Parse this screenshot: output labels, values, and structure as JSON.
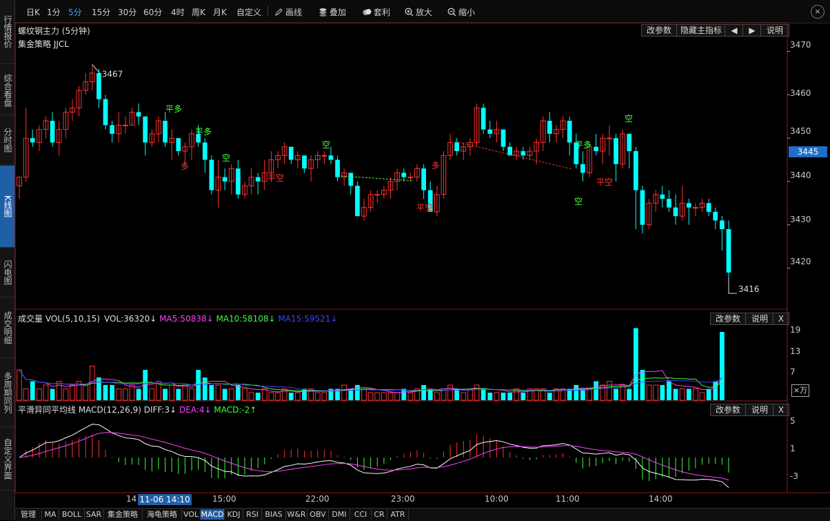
{
  "sidebar": {
    "items": [
      {
        "label": "行情报价",
        "active": false
      },
      {
        "label": "综合看盘",
        "active": false
      },
      {
        "label": "分时图",
        "active": false
      },
      {
        "label": "K线图",
        "active": true
      },
      {
        "label": "闪电图",
        "active": false
      },
      {
        "label": "成交明细",
        "active": false
      },
      {
        "label": "多周期同列",
        "active": false
      },
      {
        "label": "自定义界面",
        "active": false
      }
    ]
  },
  "toolbar": {
    "periods": [
      {
        "label": "日K",
        "active": false
      },
      {
        "label": "1分",
        "active": false
      },
      {
        "label": "5分",
        "active": true
      },
      {
        "label": "15分",
        "active": false
      },
      {
        "label": "30分",
        "active": false
      },
      {
        "label": "60分",
        "active": false
      },
      {
        "label": "4时",
        "active": false
      },
      {
        "label": "周K",
        "active": false
      },
      {
        "label": "月K",
        "active": false
      },
      {
        "label": "自定义",
        "active": false
      }
    ],
    "tools": [
      {
        "label": "画线",
        "icon": "pencil-icon"
      },
      {
        "label": "叠加",
        "icon": "stack-icon"
      },
      {
        "label": "套利",
        "icon": "coins-icon"
      },
      {
        "label": "放大",
        "icon": "zoom-in-icon"
      },
      {
        "label": "缩小",
        "icon": "zoom-out-icon"
      }
    ],
    "close": "×"
  },
  "main": {
    "contract": "螺纹钢主力 (5分钟)",
    "strategy": "集金策略 JJCL",
    "buttons": {
      "params": "改参数",
      "hide": "隐藏主指标",
      "left": "◀",
      "right": "▶",
      "help": "说明"
    },
    "high_label": "3467",
    "low_label": "3416",
    "y_ticks": [
      "3470",
      "3460",
      "3450",
      "3440",
      "3430",
      "3420"
    ],
    "current_price": "3445",
    "signals": {
      "flat_long": "平多",
      "flat_short": "平空",
      "long": "多",
      "short": "空"
    }
  },
  "volume": {
    "name": "成交量 VOL(5,10,15)",
    "vol": "VOL:36320↓",
    "ma5": "MA5:50838↓",
    "ma10": "MA10:58108↓",
    "ma15": "MA15:59521↓",
    "buttons": {
      "params": "改参数",
      "help": "说明",
      "close": "X"
    },
    "y_ticks": [
      "19",
      "13",
      "7"
    ],
    "unit": "×万",
    "colors": {
      "ma5": "#ff40ff",
      "ma10": "#40ff40",
      "ma15": "#4040ff"
    }
  },
  "macd": {
    "name": "平滑异同平均线 MACD(12,26,9)",
    "diff": "DIFF:3↓",
    "dea": "DEA:4↓",
    "macd": "MACD:-2↑",
    "buttons": {
      "params": "改参数",
      "help": "说明",
      "close": "X"
    },
    "y_ticks": [
      "5",
      "1",
      "-3"
    ],
    "colors": {
      "diff": "#ffffff",
      "dea": "#ff40ff",
      "macd": "#40ff40"
    }
  },
  "time_axis": {
    "labels": [
      "14",
      "15:00",
      "22:00",
      "23:00",
      "10:00",
      "11:00",
      "14:00"
    ],
    "cursor": "11-06 14:10"
  },
  "bottom_tabs": [
    {
      "label": "管理",
      "active": false
    },
    {
      "label": "MA",
      "active": false
    },
    {
      "label": "BOLL",
      "active": false
    },
    {
      "label": "SAR",
      "active": false
    },
    {
      "label": "集金策略",
      "active": false
    },
    {
      "label": "海龟策略",
      "active": false
    },
    {
      "label": "VOL",
      "active": false
    },
    {
      "label": "MACD",
      "active": true
    },
    {
      "label": "KDJ",
      "active": false
    },
    {
      "label": "RSI",
      "active": false
    },
    {
      "label": "BIAS",
      "active": false
    },
    {
      "label": "W&R",
      "active": false
    },
    {
      "label": "OBV",
      "active": false
    },
    {
      "label": "DMI",
      "active": false
    },
    {
      "label": "CCI",
      "active": false
    },
    {
      "label": "CR",
      "active": false
    },
    {
      "label": "ATR",
      "active": false
    }
  ],
  "chart_data": {
    "type": "candlestick",
    "ylim": [
      3415,
      3472
    ],
    "candles": [
      [
        3439,
        3441,
        3436,
        3441
      ],
      [
        3441,
        3457,
        3440,
        3450
      ],
      [
        3450,
        3452,
        3448,
        3449
      ],
      [
        3449,
        3453,
        3447,
        3452
      ],
      [
        3452,
        3455,
        3450,
        3454
      ],
      [
        3454,
        3456,
        3448,
        3449
      ],
      [
        3449,
        3454,
        3446,
        3452
      ],
      [
        3452,
        3457,
        3450,
        3456
      ],
      [
        3456,
        3459,
        3454,
        3457
      ],
      [
        3457,
        3462,
        3455,
        3461
      ],
      [
        3461,
        3465,
        3460,
        3463
      ],
      [
        3463,
        3467,
        3461,
        3465
      ],
      [
        3465,
        3466,
        3457,
        3459
      ],
      [
        3459,
        3460,
        3452,
        3453
      ],
      [
        3453,
        3454,
        3449,
        3451
      ],
      [
        3451,
        3456,
        3449,
        3453
      ],
      [
        3453,
        3455,
        3451,
        3453
      ],
      [
        3453,
        3457,
        3453,
        3456
      ],
      [
        3456,
        3458,
        3453,
        3455
      ],
      [
        3455,
        3455,
        3446,
        3449
      ],
      [
        3449,
        3452,
        3448,
        3451
      ],
      [
        3451,
        3455,
        3449,
        3454
      ],
      [
        3454,
        3456,
        3448,
        3449
      ],
      [
        3449,
        3452,
        3445,
        3450
      ],
      [
        3450,
        3450,
        3446,
        3447
      ],
      [
        3447,
        3449,
        3444,
        3448
      ],
      [
        3448,
        3452,
        3445,
        3451
      ],
      [
        3451,
        3453,
        3448,
        3449
      ],
      [
        3449,
        3450,
        3442,
        3445
      ],
      [
        3445,
        3446,
        3437,
        3438
      ],
      [
        3438,
        3445,
        3434,
        3441
      ],
      [
        3441,
        3443,
        3438,
        3440
      ],
      [
        3440,
        3444,
        3437,
        3443
      ],
      [
        3443,
        3445,
        3436,
        3437
      ],
      [
        3437,
        3440,
        3436,
        3439
      ],
      [
        3439,
        3443,
        3437,
        3441
      ],
      [
        3441,
        3442,
        3437,
        3440
      ],
      [
        3440,
        3445,
        3438,
        3442
      ],
      [
        3442,
        3447,
        3440,
        3445
      ],
      [
        3445,
        3447,
        3443,
        3446
      ],
      [
        3446,
        3449,
        3444,
        3448
      ],
      [
        3448,
        3448,
        3444,
        3445
      ],
      [
        3445,
        3447,
        3443,
        3446
      ],
      [
        3446,
        3446,
        3442,
        3443
      ],
      [
        3443,
        3446,
        3440,
        3445
      ],
      [
        3445,
        3447,
        3443,
        3446
      ],
      [
        3446,
        3447,
        3444,
        3446
      ],
      [
        3446,
        3448,
        3444,
        3445
      ],
      [
        3445,
        3446,
        3440,
        3441
      ],
      [
        3441,
        3443,
        3439,
        3442
      ],
      [
        3442,
        3442,
        3437,
        3439
      ],
      [
        3439,
        3440,
        3433,
        3432
      ],
      [
        3432,
        3436,
        3431,
        3434
      ],
      [
        3434,
        3438,
        3433,
        3437
      ],
      [
        3437,
        3438,
        3435,
        3437
      ],
      [
        3437,
        3439,
        3436,
        3438
      ],
      [
        3438,
        3441,
        3436,
        3440
      ],
      [
        3440,
        3443,
        3438,
        3442
      ],
      [
        3442,
        3443,
        3440,
        3441
      ],
      [
        3441,
        3442,
        3440,
        3441
      ],
      [
        3441,
        3444,
        3440,
        3443
      ],
      [
        3443,
        3444,
        3436,
        3438
      ],
      [
        3438,
        3440,
        3433,
        3433
      ],
      [
        3433,
        3439,
        3432,
        3437
      ],
      [
        3437,
        3447,
        3436,
        3446
      ],
      [
        3446,
        3451,
        3445,
        3449
      ],
      [
        3449,
        3450,
        3446,
        3447
      ],
      [
        3447,
        3449,
        3445,
        3448
      ],
      [
        3448,
        3450,
        3446,
        3449
      ],
      [
        3449,
        3458,
        3448,
        3457
      ],
      [
        3457,
        3458,
        3451,
        3452
      ],
      [
        3452,
        3454,
        3450,
        3451
      ],
      [
        3451,
        3454,
        3449,
        3452
      ],
      [
        3452,
        3452,
        3447,
        3448
      ],
      [
        3448,
        3449,
        3446,
        3446
      ],
      [
        3446,
        3448,
        3445,
        3447
      ],
      [
        3447,
        3448,
        3445,
        3446
      ],
      [
        3446,
        3448,
        3445,
        3447
      ],
      [
        3447,
        3450,
        3444,
        3449
      ],
      [
        3449,
        3455,
        3447,
        3454
      ],
      [
        3454,
        3456,
        3449,
        3451
      ],
      [
        3451,
        3453,
        3449,
        3452
      ],
      [
        3452,
        3455,
        3450,
        3454
      ],
      [
        3454,
        3455,
        3446,
        3449
      ],
      [
        3449,
        3451,
        3443,
        3444
      ],
      [
        3444,
        3447,
        3440,
        3442
      ],
      [
        3442,
        3449,
        3441,
        3448
      ],
      [
        3448,
        3451,
        3446,
        3447
      ],
      [
        3447,
        3451,
        3444,
        3450
      ],
      [
        3450,
        3453,
        3446,
        3450
      ],
      [
        3450,
        3451,
        3440,
        3444
      ],
      [
        3444,
        3452,
        3443,
        3451
      ],
      [
        3451,
        3451,
        3443,
        3447
      ],
      [
        3447,
        3448,
        3429,
        3438
      ],
      [
        3438,
        3439,
        3428,
        3430
      ],
      [
        3430,
        3436,
        3429,
        3435
      ],
      [
        3435,
        3438,
        3433,
        3437
      ],
      [
        3437,
        3439,
        3434,
        3436
      ],
      [
        3436,
        3438,
        3433,
        3434
      ],
      [
        3434,
        3437,
        3430,
        3432
      ],
      [
        3432,
        3439,
        3431,
        3435
      ],
      [
        3435,
        3436,
        3430,
        3434
      ],
      [
        3434,
        3435,
        3432,
        3434
      ],
      [
        3434,
        3436,
        3433,
        3435
      ],
      [
        3435,
        3436,
        3432,
        3433
      ],
      [
        3433,
        3434,
        3429,
        3431
      ],
      [
        3431,
        3432,
        3424,
        3429
      ],
      [
        3429,
        3431,
        3418,
        3419
      ]
    ],
    "volume": [
      8,
      3,
      5,
      3,
      4,
      3,
      5,
      3,
      4,
      5,
      4,
      9,
      6,
      4,
      4,
      3,
      3,
      4,
      3,
      8,
      3,
      5,
      3,
      4,
      3,
      4,
      3,
      8,
      6,
      4,
      4,
      3,
      3,
      4,
      3,
      2,
      2,
      3,
      2,
      2,
      3,
      2,
      2,
      3,
      3,
      2,
      2,
      3,
      3,
      4,
      3,
      4,
      3,
      2,
      2,
      2,
      2,
      2,
      3,
      2,
      3,
      4,
      3,
      2,
      3,
      4,
      3,
      2,
      3,
      4,
      3,
      2,
      2,
      2,
      2,
      3,
      2,
      3,
      3,
      3,
      2,
      3,
      3,
      3,
      4,
      3,
      3,
      5,
      4,
      5,
      3,
      4,
      3,
      19,
      8,
      4,
      4,
      4,
      5,
      3,
      3,
      3,
      3,
      2,
      3,
      5,
      18
    ],
    "macd": {
      "diff_range": [
        -4,
        7
      ],
      "dea_range": [
        -4,
        6
      ]
    }
  }
}
